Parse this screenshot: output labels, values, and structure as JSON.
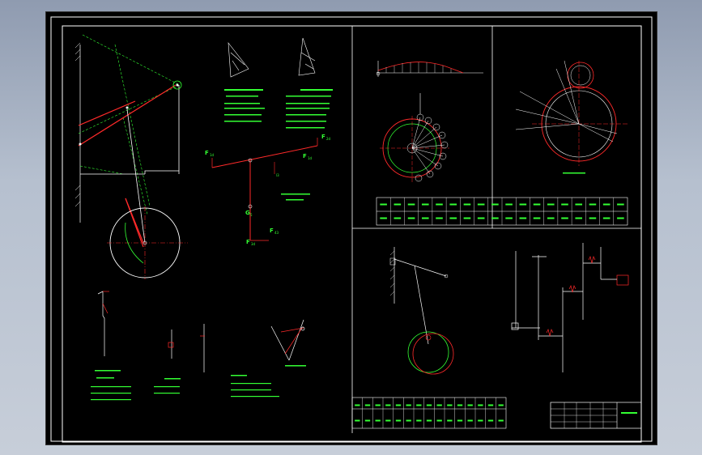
{
  "drawing": {
    "background": "#000000",
    "colors": {
      "frame": "#ffffff",
      "line": "#ffffff",
      "red": "#ff2a2a",
      "green": "#33ff33",
      "dash": "#33ff33",
      "magenta": "#ff33ff",
      "cyan": "#33ffff"
    }
  },
  "labels": {
    "f_left": "F",
    "f_left_sub": "1d",
    "f_right_top": "F",
    "f_right_top_sub": "2d",
    "f_mid": "F",
    "f_mid_sub": "1d",
    "g_label": "G",
    "g_sub": "5",
    "f_bottom": "F",
    "f_bottom_sub": "3d",
    "f_bottom2": "F",
    "f_bottom2_sub": "43",
    "rod_label": "l3"
  },
  "table_top": {
    "rows": [
      [
        "",
        "",
        "",
        "",
        "",
        "",
        "",
        "",
        "",
        "",
        "",
        "",
        "",
        "",
        "",
        "",
        "",
        ""
      ],
      [
        "",
        "",
        "",
        "",
        "",
        "",
        "",
        "",
        "",
        "",
        "",
        "",
        "",
        "",
        "",
        "",
        "",
        ""
      ]
    ]
  },
  "table_bottom": {
    "rows": [
      [
        "",
        "",
        "",
        "",
        "",
        "",
        "",
        "",
        "",
        "",
        "",
        "",
        "",
        "",
        ""
      ],
      [
        "",
        "",
        "",
        "",
        "",
        "",
        "",
        "",
        "",
        "",
        "",
        "",
        "",
        "",
        ""
      ]
    ]
  },
  "title_block": {
    "name": ""
  }
}
